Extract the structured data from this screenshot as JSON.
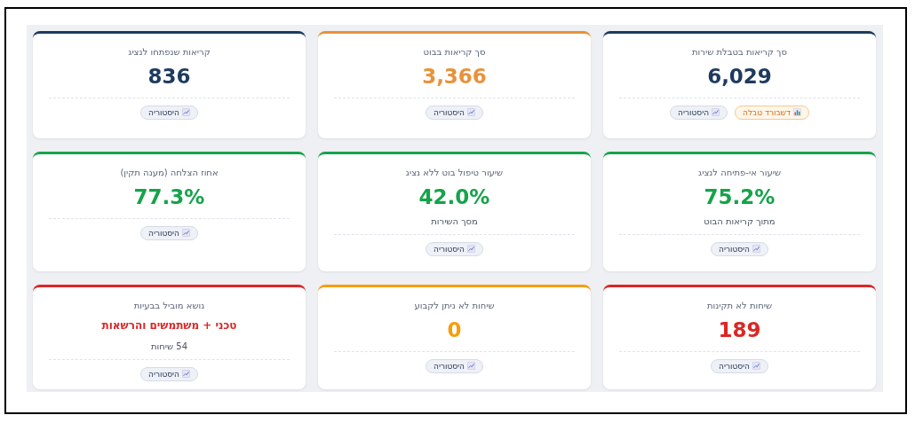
{
  "cards": [
    {
      "kind": "number",
      "color": "#1e3a5f",
      "title": "סך קריאות בטבלת שירות",
      "value": "6,029",
      "buttons": [
        {
          "kind": "table",
          "label": "דשבורד טבלה"
        },
        {
          "kind": "history",
          "label": "היסטוריה"
        }
      ]
    },
    {
      "kind": "number",
      "color": "#e8923a",
      "title": "סך קריאות בבוט",
      "value": "3,366",
      "buttons": [
        {
          "kind": "history",
          "label": "היסטוריה"
        }
      ]
    },
    {
      "kind": "number",
      "color": "#1e3a5f",
      "title": "קריאות שנפתחו לנציג",
      "value": "836",
      "buttons": [
        {
          "kind": "history",
          "label": "היסטוריה"
        }
      ]
    },
    {
      "kind": "number",
      "color": "#16a34a",
      "title": "שיעור אי-פתיחה לנציג",
      "value": "75.2%",
      "note": "מתוך קריאות הבוט",
      "buttons": [
        {
          "kind": "history",
          "label": "היסטוריה"
        }
      ]
    },
    {
      "kind": "number",
      "color": "#16a34a",
      "title": "שיעור טיפול בוט ללא נציג",
      "value": "42.0%",
      "note": "מסך השירות",
      "buttons": [
        {
          "kind": "history",
          "label": "היסטוריה"
        }
      ]
    },
    {
      "kind": "number",
      "color": "#16a34a",
      "title": "אחוז הצלחה (מענה תקין)",
      "value": "77.3%",
      "buttons": [
        {
          "kind": "history",
          "label": "היסטוריה"
        }
      ]
    },
    {
      "kind": "number",
      "color": "#dc2626",
      "title": "שיחות לא תקינות",
      "value": "189",
      "buttons": [
        {
          "kind": "history",
          "label": "היסטוריה"
        }
      ]
    },
    {
      "kind": "number",
      "color": "#f59e0b",
      "title": "שיחות לא ניתן לקבוע",
      "value": "0",
      "buttons": [
        {
          "kind": "history",
          "label": "היסטוריה"
        }
      ]
    },
    {
      "kind": "topic",
      "color": "#dc2626",
      "title": "נושא מוביל בבעיות",
      "value": "טכני + משתמשים והרשאות",
      "note": "54 שיחות",
      "buttons": [
        {
          "kind": "history",
          "label": "היסטוריה"
        }
      ]
    }
  ]
}
